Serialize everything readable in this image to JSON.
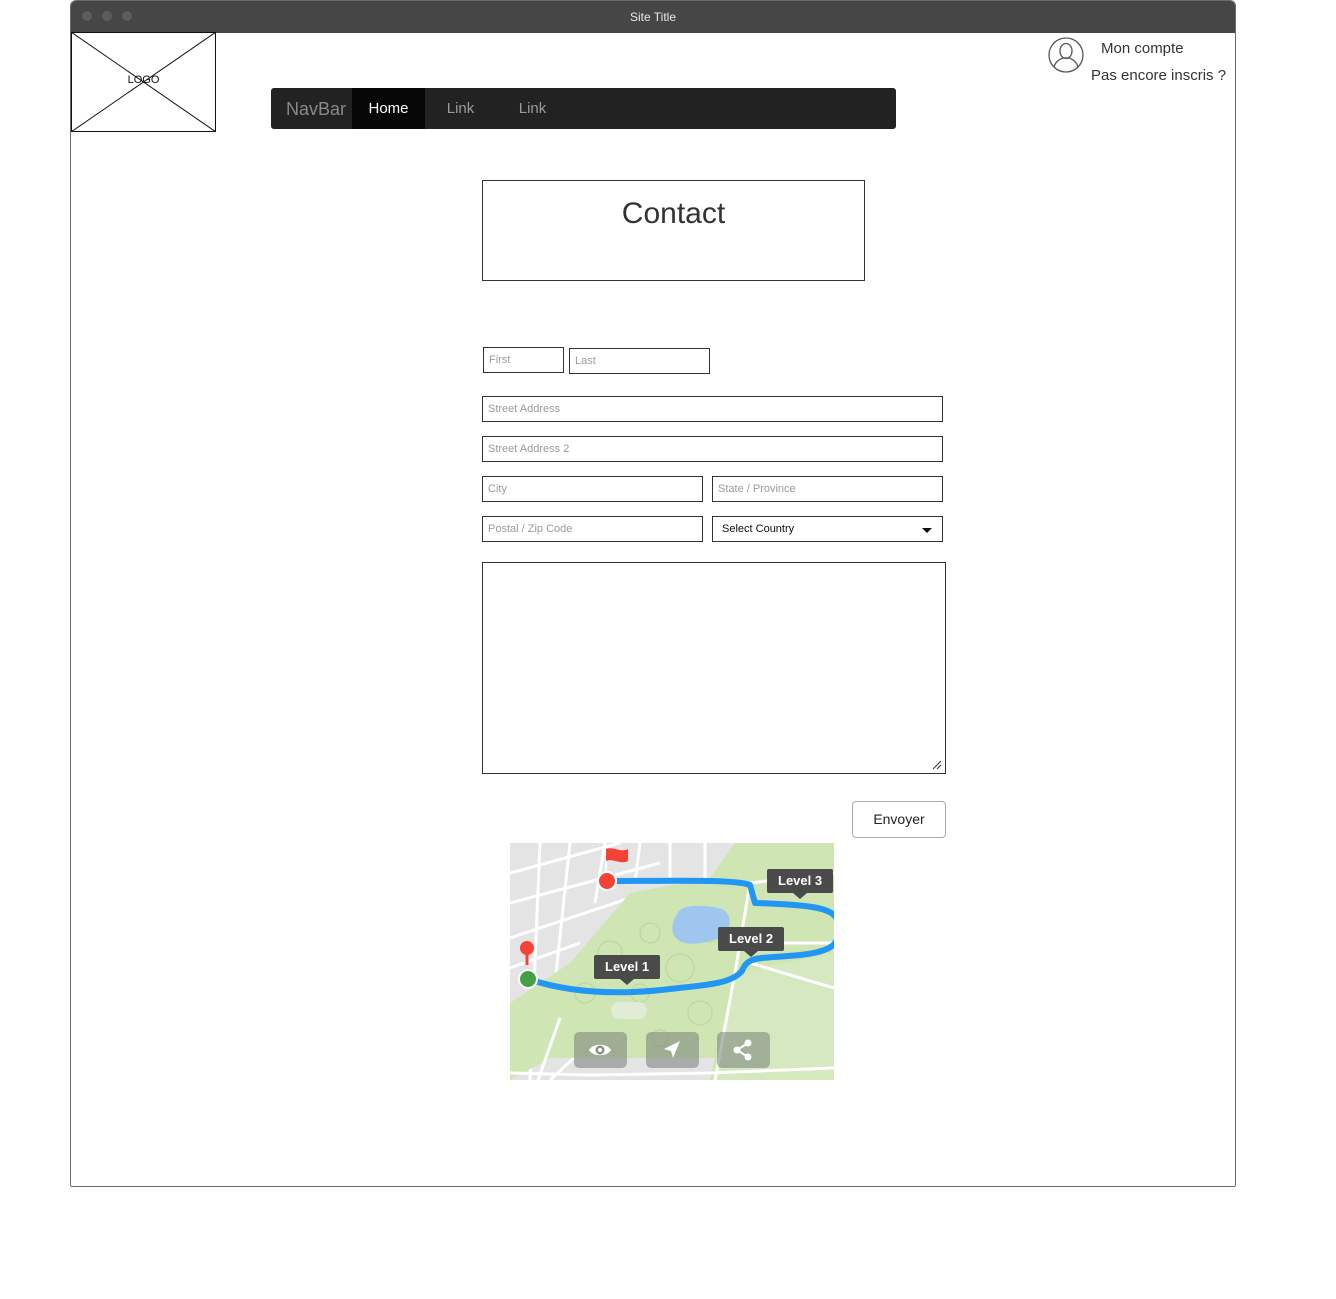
{
  "window": {
    "title": "Site Title"
  },
  "logo": {
    "text": "LOGO"
  },
  "navbar": {
    "brand": "NavBar",
    "items": [
      {
        "label": "Home",
        "active": true
      },
      {
        "label": "Link"
      },
      {
        "label": "Link"
      }
    ]
  },
  "account": {
    "my_account": "Mon compte",
    "not_registered": "Pas encore inscris ?"
  },
  "contact": {
    "title": "Contact"
  },
  "form": {
    "first_placeholder": "First",
    "last_placeholder": "Last",
    "street_placeholder": "Street Address",
    "street2_placeholder": "Street Address 2",
    "city_placeholder": "City",
    "state_placeholder": "State / Province",
    "postal_placeholder": "Postal / Zip Code",
    "country_selected": "Select Country",
    "submit_label": "Envoyer"
  },
  "map": {
    "markers": [
      {
        "label": "Level 1"
      },
      {
        "label": "Level 2"
      },
      {
        "label": "Level 3"
      }
    ],
    "icons": [
      "eye-icon",
      "navigate-icon",
      "share-icon"
    ],
    "colors": {
      "route": "#2196f3",
      "park": "#cfe5b3",
      "start": "#43a047",
      "end": "#f44336"
    }
  }
}
